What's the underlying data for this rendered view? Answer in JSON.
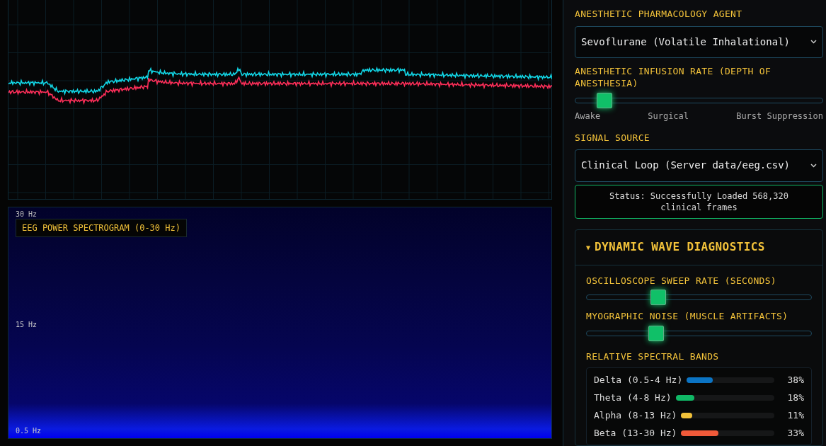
{
  "spectrogram": {
    "title": "EEG POWER SPECTROGRAM (0-30 Hz)",
    "y_labels": [
      "30 Hz",
      "15 Hz",
      "0.5 Hz"
    ]
  },
  "controls": {
    "agent": {
      "label": "ANESTHETIC PHARMACOLOGY AGENT",
      "value": "Sevoflurane (Volatile Inhalational)"
    },
    "infusion": {
      "label": "ANESTHETIC INFUSION RATE (DEPTH OF ANESTHESIA)",
      "level": 0.12,
      "scale": [
        "Awake",
        "Surgical",
        "Burst Suppression"
      ]
    },
    "source": {
      "label": "SIGNAL SOURCE",
      "value": "Clinical Loop (Server data/eeg.csv)"
    },
    "status": "Status: Successfully Loaded 568,320 clinical frames"
  },
  "diagnostics": {
    "title": "DYNAMIC WAVE DIAGNOSTICS",
    "expanded": true,
    "toggle": "▼",
    "sliders": [
      {
        "label": "OSCILLOSCOPE SWEEP RATE (SECONDS)",
        "level": 0.32
      },
      {
        "label": "MYOGRAPHIC NOISE (MUSCLE ARTIFACTS)",
        "level": 0.31
      }
    ],
    "bands_title": "RELATIVE SPECTRAL BANDS",
    "bands": [
      {
        "name": "Delta (0.5-4 Hz)",
        "level": 0.3,
        "reading": "38%",
        "color": "#0b74c4"
      },
      {
        "name": "Theta (4-8 Hz)",
        "level": 0.19,
        "reading": "18%",
        "color": "#10b866"
      },
      {
        "name": "Alpha (8-13 Hz)",
        "level": 0.12,
        "reading": "11%",
        "color": "#f2c23a"
      },
      {
        "name": "Beta (13-30 Hz)",
        "level": 0.4,
        "reading": "33%",
        "color": "#f05a3a"
      }
    ]
  }
}
